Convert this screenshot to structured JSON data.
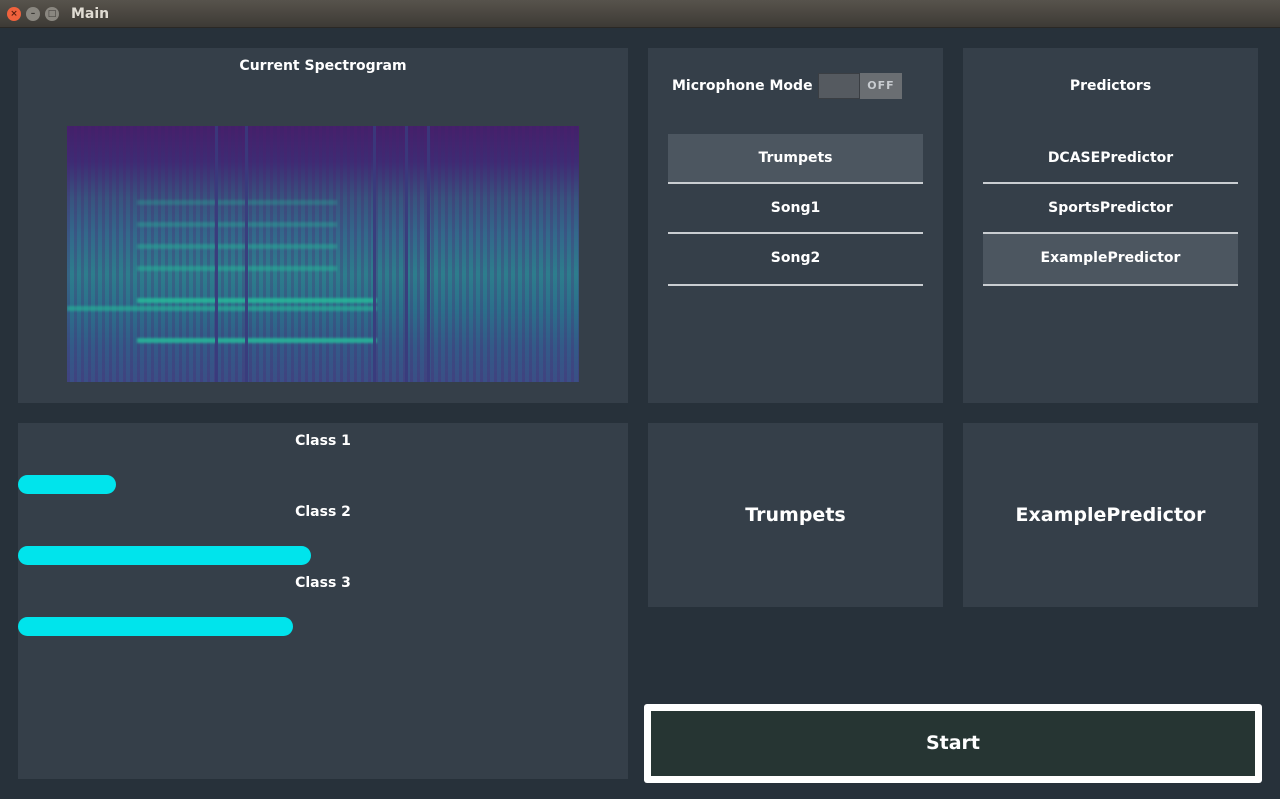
{
  "window": {
    "title": "Main"
  },
  "spectrogram": {
    "title": "Current Spectrogram"
  },
  "microphone": {
    "label": "Microphone Mode",
    "toggle_state": "OFF"
  },
  "songs": {
    "items": [
      {
        "label": "Trumpets",
        "selected": true
      },
      {
        "label": "Song1",
        "selected": false
      },
      {
        "label": "Song2",
        "selected": false
      }
    ]
  },
  "predictors": {
    "title": "Predictors",
    "items": [
      {
        "label": "DCASEPredictor",
        "selected": false
      },
      {
        "label": "SportsPredictor",
        "selected": false
      },
      {
        "label": "ExamplePredictor",
        "selected": true
      }
    ]
  },
  "classes": [
    {
      "label": "Class 1",
      "value": 0.16
    },
    {
      "label": "Class 2",
      "value": 0.48
    },
    {
      "label": "Class 3",
      "value": 0.45
    }
  ],
  "selected_song": "Trumpets",
  "selected_predictor": "ExamplePredictor",
  "start": {
    "label": "Start"
  },
  "colors": {
    "bar": "#00e4ec",
    "panel": "#353f49",
    "background": "#27313a",
    "start_bg": "#263533"
  }
}
